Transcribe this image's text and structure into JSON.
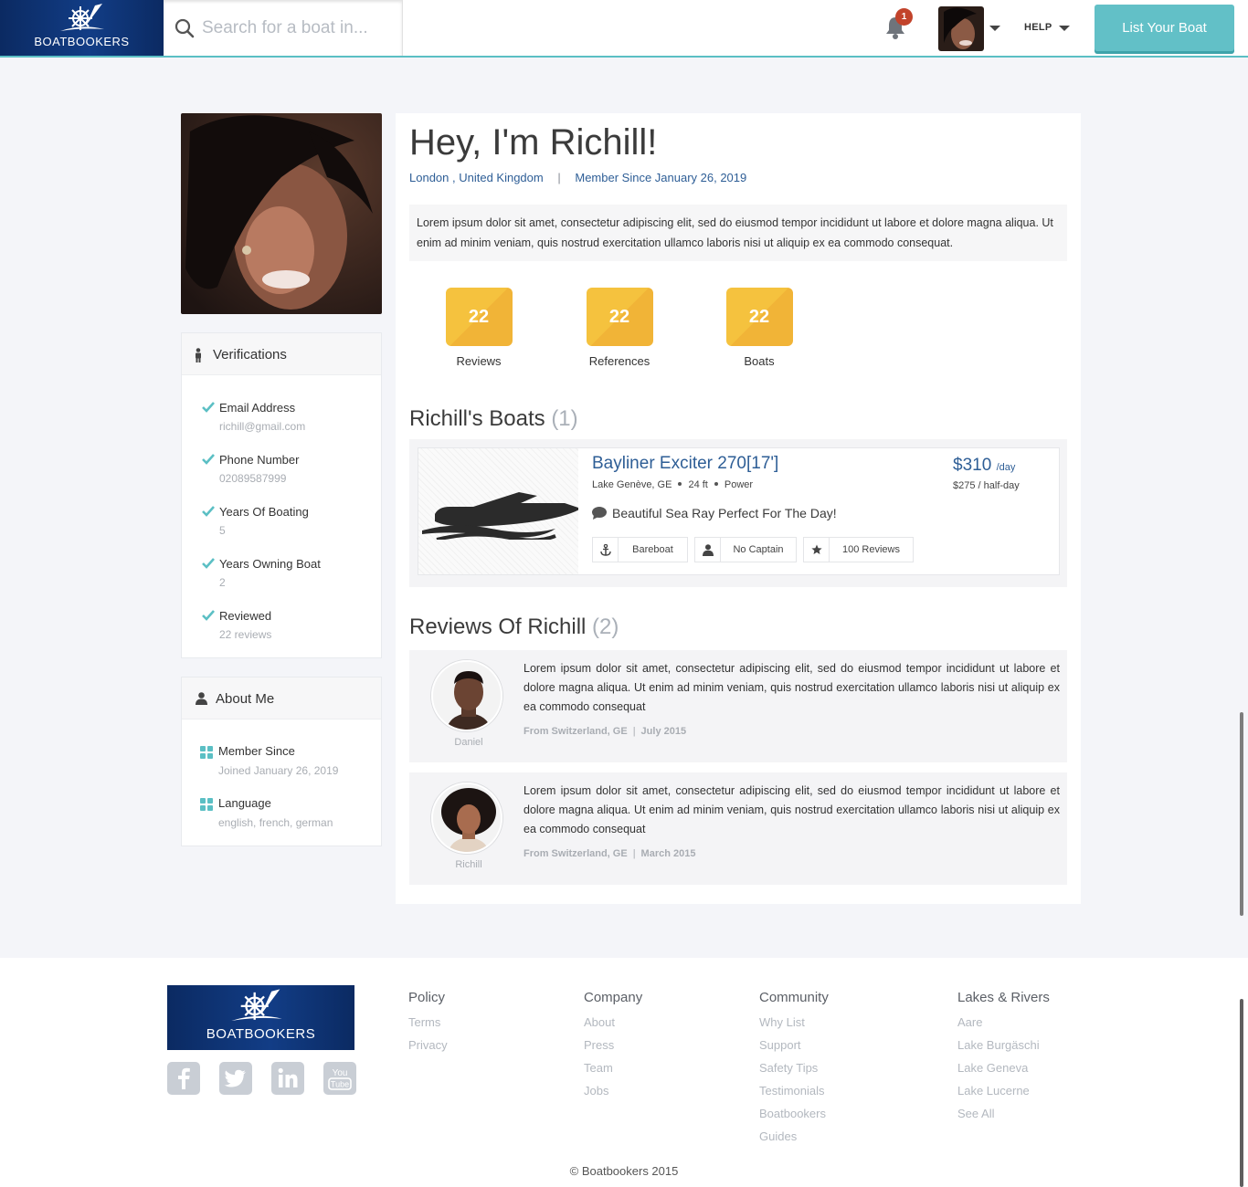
{
  "header": {
    "logo_text": "BOATBOOKERS",
    "search_placeholder": "Search for a boat in...",
    "notification_count": "1",
    "help_label": "HELP",
    "list_boat_label": "List Your Boat"
  },
  "profile": {
    "greeting": "Hey, I'm Richill!",
    "location": "London , United Kingdom",
    "separator": "|",
    "member_since": "Member Since January 26, 2019",
    "bio": "Lorem ipsum dolor sit amet, consectetur adipiscing elit, sed do eiusmod tempor incididunt ut labore et dolore magna aliqua. Ut enim ad minim veniam, quis nostrud exercitation ullamco laboris nisi ut aliquip ex ea commodo consequat."
  },
  "stats": [
    {
      "value": "22",
      "label": "Reviews"
    },
    {
      "value": "22",
      "label": "References"
    },
    {
      "value": "22",
      "label": "Boats"
    }
  ],
  "verifications": {
    "title": "Verifications",
    "items": [
      {
        "label": "Email Address",
        "value": "richill@gmail.com"
      },
      {
        "label": "Phone Number",
        "value": "02089587999"
      },
      {
        "label": "Years Of Boating",
        "value": "5"
      },
      {
        "label": "Years Owning Boat",
        "value": "2"
      },
      {
        "label": "Reviewed",
        "value": "22 reviews"
      }
    ]
  },
  "about": {
    "title": "About Me",
    "items": [
      {
        "label": "Member Since",
        "value": "Joined January 26, 2019"
      },
      {
        "label": "Language",
        "value": "english, french, german"
      }
    ]
  },
  "boats_section": {
    "title": "Richill's Boats",
    "count": "(1)"
  },
  "boat": {
    "title": "Bayliner Exciter 270[17']",
    "location": "Lake Genève, GE",
    "length": "24 ft",
    "type": "Power",
    "description": "Beautiful Sea Ray Perfect For The Day!",
    "price": "$310",
    "price_unit": "/day",
    "half_day": "$275 / half-day",
    "tags": [
      "Bareboat",
      "No Captain",
      "100 Reviews"
    ]
  },
  "reviews_section": {
    "title": "Reviews Of Richill",
    "count": "(2)"
  },
  "reviews": [
    {
      "name": "Daniel",
      "text": "Lorem ipsum dolor sit amet, consectetur adipiscing elit, sed do eiusmod tempor incididunt ut labore et dolore magna aliqua. Ut enim ad minim veniam, quis nostrud exercitation ullamco laboris nisi ut aliquip ex ea commodo consequat",
      "from": "From Switzerland, GE",
      "date": "July 2015"
    },
    {
      "name": "Richill",
      "text": "Lorem ipsum dolor sit amet, consectetur adipiscing elit, sed do eiusmod tempor incididunt ut labore et dolore magna aliqua. Ut enim ad minim veniam, quis nostrud exercitation ullamco laboris nisi ut aliquip ex ea commodo consequat",
      "from": "From Switzerland, GE",
      "date": "March 2015"
    }
  ],
  "footer": {
    "logo_text": "BOATBOOKERS",
    "social_icons": [
      "facebook-icon",
      "twitter-icon",
      "linkedin-icon",
      "youtube-icon"
    ],
    "columns": [
      {
        "title": "Policy",
        "links": [
          "Terms",
          "Privacy"
        ]
      },
      {
        "title": "Company",
        "links": [
          "About",
          "Press",
          "Team",
          "Jobs"
        ]
      },
      {
        "title": "Community",
        "links": [
          "Why List",
          "Support",
          "Safety Tips",
          "Testimonials",
          "Boatbookers",
          "Guides"
        ]
      },
      {
        "title": "Lakes & Rivers",
        "links": [
          "Aare",
          "Lake Burgäschi",
          "Lake Geneva",
          "Lake Lucerne",
          "See All"
        ]
      }
    ],
    "copyright": "© Boatbookers 2015"
  },
  "colors": {
    "accent_teal": "#62c0c7",
    "link_blue": "#2e5e96",
    "stat_gold": "#f5c23e",
    "brand_navy": "#0b2a62"
  }
}
